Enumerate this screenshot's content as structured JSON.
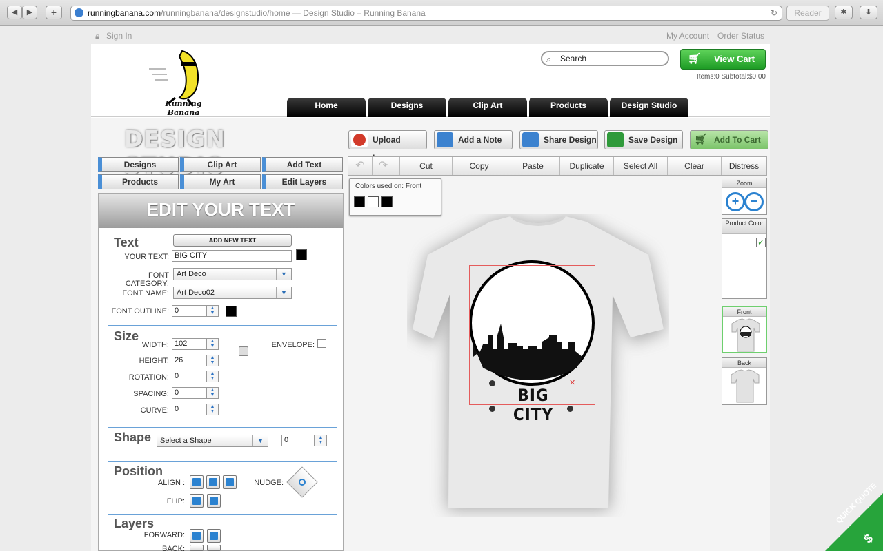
{
  "browser": {
    "url_domain": "runningbanana.com",
    "url_path": "/runningbanana/designstudio/home",
    "page_title": " — Design Studio – Running Banana",
    "reader": "Reader"
  },
  "topbar": {
    "sign_in": "Sign In",
    "my_account": "My Account",
    "order_status": "Order Status"
  },
  "header": {
    "logo_text": "Running Banana",
    "search_placeholder": "Search",
    "view_cart": "View Cart",
    "cart_info": "Items:0  Subtotal:$0.00",
    "nav": [
      "Home",
      "Designs",
      "Clip Art",
      "Products",
      "Design Studio"
    ]
  },
  "studio": {
    "title": "DESIGN STUDIO",
    "actions": [
      "Upload Image",
      "Add a Note",
      "Share Design",
      "Save Design",
      "Add To Cart"
    ],
    "nav_buttons": [
      "Designs",
      "Clip Art",
      "Add Text",
      "Products",
      "My Art",
      "Edit Layers"
    ],
    "toolbar": [
      "Cut",
      "Copy",
      "Paste",
      "Duplicate",
      "Select All",
      "Clear",
      "Distress"
    ],
    "colors_label": "Colors used on: Front",
    "colors": [
      "#000000",
      "#ffffff",
      "#000000"
    ]
  },
  "panel": {
    "heading": "EDIT YOUR TEXT",
    "text_section": "Text",
    "add_new_text": "ADD NEW TEXT",
    "your_text_label": "YOUR TEXT:",
    "your_text_value": "BIG CITY",
    "font_category_label": "FONT CATEGORY:",
    "font_category_value": "Art Deco",
    "font_name_label": "FONT NAME:",
    "font_name_value": "Art Deco02",
    "font_outline_label": "FONT OUTLINE:",
    "font_outline_value": "0",
    "size_section": "Size",
    "width_label": "WIDTH:",
    "width_value": "102",
    "height_label": "HEIGHT:",
    "height_value": "26",
    "envelope_label": "ENVELOPE:",
    "rotation_label": "ROTATION:",
    "rotation_value": "0",
    "spacing_label": "SPACING:",
    "spacing_value": "0",
    "curve_label": "CURVE:",
    "curve_value": "0",
    "shape_section": "Shape",
    "shape_select": "Select a Shape",
    "shape_value": "0",
    "position_section": "Position",
    "align_label": "ALIGN :",
    "nudge_label": "NUDGE:",
    "flip_label": "FLIP:",
    "layers_section": "Layers",
    "forward_label": "FORWARD:",
    "back_label": "BACK:"
  },
  "design": {
    "text": "BIG CITY"
  },
  "right": {
    "zoom": "Zoom",
    "product_color": "Product Color",
    "front": "Front",
    "back": "Back"
  },
  "quick_quote": "QUICK QUOTE"
}
